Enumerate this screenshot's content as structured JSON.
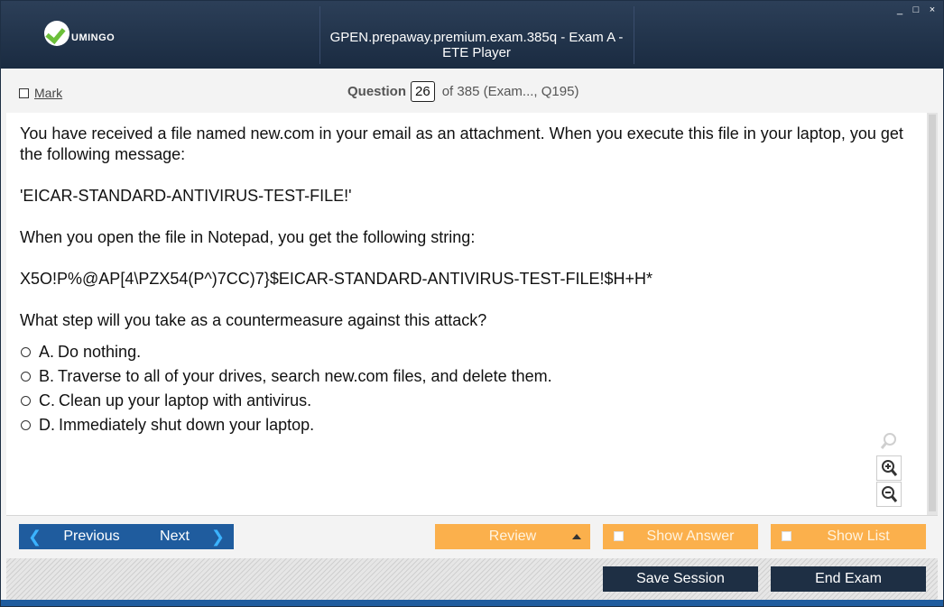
{
  "window": {
    "title": "GPEN.prepaway.premium.exam.385q - Exam A - ETE Player",
    "logo_text": "UMINGO",
    "controls": [
      "_",
      "□",
      "×"
    ]
  },
  "header": {
    "mark_label": "Mark",
    "question_word": "Question",
    "question_number": "26",
    "question_of": "of 385 (Exam..., Q195)"
  },
  "question": {
    "paragraphs": [
      "You have received a file named new.com in your email as an attachment. When you execute this file in your laptop, you get the following message:",
      "'EICAR-STANDARD-ANTIVIRUS-TEST-FILE!'",
      "When you open the file in Notepad, you get the following string:",
      "X5O!P%@AP[4\\PZX54(P^)7CC)7}$EICAR-STANDARD-ANTIVIRUS-TEST-FILE!$H+H*",
      "What step will you take as a countermeasure against this attack?"
    ],
    "options": [
      {
        "letter": "A.",
        "text": "Do nothing."
      },
      {
        "letter": "B.",
        "text": "Traverse to all of your drives, search new.com files, and delete them."
      },
      {
        "letter": "C.",
        "text": "Clean up your laptop with antivirus."
      },
      {
        "letter": "D.",
        "text": "Immediately shut down your laptop."
      }
    ]
  },
  "nav": {
    "previous": "Previous",
    "next": "Next",
    "review": "Review",
    "show_answer": "Show Answer",
    "show_list": "Show List",
    "save_session": "Save Session",
    "end_exam": "End Exam"
  },
  "icons": {
    "zoom_search": "magnifier-icon",
    "zoom_in": "zoom-in-icon",
    "zoom_out": "zoom-out-icon"
  },
  "colors": {
    "titlebar": "#1e2f44",
    "nav_blue": "#1f5c9e",
    "nav_orange": "#fbb04c",
    "accent_arrow": "#3bb3ff",
    "logo_green": "#6cbf3a"
  }
}
